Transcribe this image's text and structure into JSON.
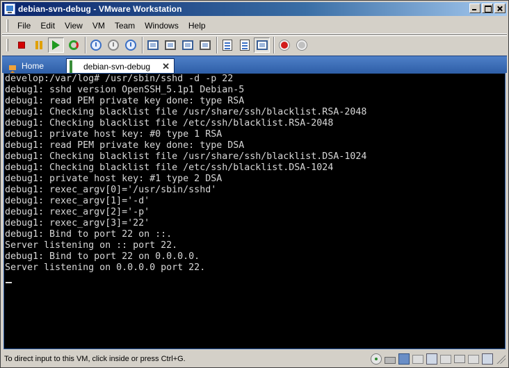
{
  "window": {
    "title": "debian-svn-debug - VMware Workstation"
  },
  "menubar": {
    "items": [
      "File",
      "Edit",
      "View",
      "VM",
      "Team",
      "Windows",
      "Help"
    ]
  },
  "toolbar": {
    "icons": [
      "power-off-icon",
      "suspend-icon",
      "power-on-icon",
      "reset-icon",
      "snapshot-icon",
      "revert-snapshot-icon",
      "snapshot-manager-icon",
      "quick-switch-icon",
      "full-screen-icon",
      "unity-icon",
      "summary-view-icon",
      "console-view-icon",
      "appliance-view-icon",
      "record-icon",
      "replay-icon"
    ]
  },
  "tabs": [
    {
      "label": "Home",
      "active": false
    },
    {
      "label": "debian-svn-debug",
      "active": true
    }
  ],
  "console": {
    "lines": [
      "develop:/var/log# /usr/sbin/sshd -d -p 22",
      "debug1: sshd version OpenSSH_5.1p1 Debian-5",
      "debug1: read PEM private key done: type RSA",
      "debug1: Checking blacklist file /usr/share/ssh/blacklist.RSA-2048",
      "debug1: Checking blacklist file /etc/ssh/blacklist.RSA-2048",
      "debug1: private host key: #0 type 1 RSA",
      "debug1: read PEM private key done: type DSA",
      "debug1: Checking blacklist file /usr/share/ssh/blacklist.DSA-1024",
      "debug1: Checking blacklist file /etc/ssh/blacklist.DSA-1024",
      "debug1: private host key: #1 type 2 DSA",
      "debug1: rexec_argv[0]='/usr/sbin/sshd'",
      "debug1: rexec_argv[1]='-d'",
      "debug1: rexec_argv[2]='-p'",
      "debug1: rexec_argv[3]='22'",
      "debug1: Bind to port 22 on ::.",
      "Server listening on :: port 22.",
      "debug1: Bind to port 22 on 0.0.0.0.",
      "Server listening on 0.0.0.0 port 22."
    ]
  },
  "statusbar": {
    "text": "To direct input to this VM, click inside or press Ctrl+G."
  },
  "colors": {
    "titlebar": "#0a246a",
    "tabbar": "#3a6ea5",
    "console_bg": "#000000",
    "console_fg": "#d8d8d8"
  }
}
